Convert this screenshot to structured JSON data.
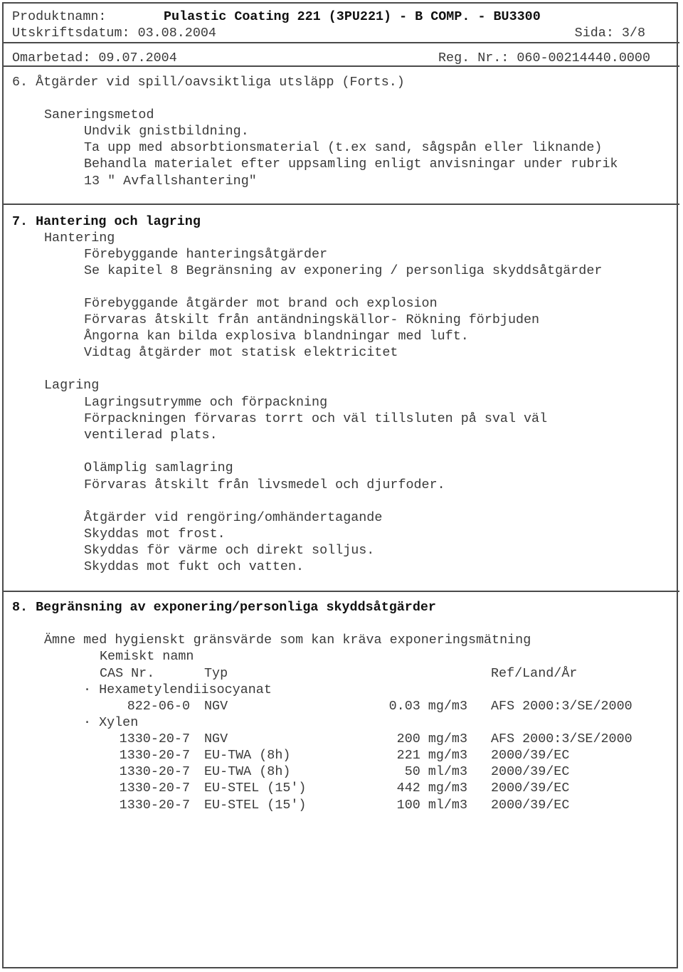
{
  "header": {
    "product_label": "Produktnamn:",
    "product_name": "Pulastic Coating 221 (3PU221) - B COMP. - BU3300",
    "print_date_label": "Utskriftsdatum: 03.08.2004",
    "page": "Sida: 3/8",
    "revised": "Omarbetad: 09.07.2004",
    "reg_nr": "Reg. Nr.: 060-00214440.0000"
  },
  "section6": {
    "title": "6. Åtgärder vid spill/oavsiktliga utsläpp (Forts.)",
    "subheading": "Saneringsmetod",
    "lines": [
      "Undvik gnistbildning.",
      "Ta upp med absorbtionsmaterial (t.ex sand, sågspån eller liknande)",
      "Behandla materialet efter uppsamling enligt anvisningar under rubrik",
      "13 \" Avfallshantering\""
    ]
  },
  "section7": {
    "title": "7. Hantering och lagring",
    "handling_heading": "Hantering",
    "handling_lines": [
      "Förebyggande hanteringsåtgärder",
      "Se kapitel 8 Begränsning av exponering / personliga skyddsåtgärder",
      "Förebyggande åtgärder mot brand och explosion",
      "Förvaras åtskilt från antändningskällor- Rökning förbjuden",
      "Ångorna kan bilda explosiva blandningar med luft.",
      "Vidtag åtgärder mot statisk elektricitet"
    ],
    "storage_heading": "Lagring",
    "storage_lines": [
      "Lagringsutrymme och förpackning",
      "Förpackningen förvaras torrt och väl tillsluten på sval väl",
      "ventilerad plats.",
      "Olämplig samlagring",
      "Förvaras åtskilt från livsmedel och djurfoder.",
      "Åtgärder vid rengöring/omhändertagande",
      "Skyddas mot frost.",
      "Skyddas för värme och direkt solljus.",
      "Skyddas mot fukt och vatten."
    ]
  },
  "section8": {
    "title": "8. Begränsning av exponering/personliga skyddsåtgärder",
    "intro": "Ämne med hygienskt gränsvärde som kan kräva exponeringsmätning",
    "col_chem": "Kemiskt namn",
    "col_cas": "CAS Nr.",
    "col_type": "Typ",
    "col_ref": "Ref/Land/År",
    "substances": [
      {
        "name": "· Hexametylendiisocyanat",
        "rows": [
          {
            "cas": "822-06-0",
            "type": "NGV",
            "value": "0.03 mg/m3",
            "ref": "AFS 2000:3/SE/2000"
          }
        ]
      },
      {
        "name": "· Xylen",
        "rows": [
          {
            "cas": "1330-20-7",
            "type": "NGV",
            "value": "200 mg/m3",
            "ref": "AFS 2000:3/SE/2000"
          },
          {
            "cas": "1330-20-7",
            "type": "EU-TWA (8h)",
            "value": "221 mg/m3",
            "ref": "2000/39/EC"
          },
          {
            "cas": "1330-20-7",
            "type": "EU-TWA (8h)",
            "value": "50 ml/m3",
            "ref": "2000/39/EC"
          },
          {
            "cas": "1330-20-7",
            "type": "EU-STEL (15')",
            "value": "442 mg/m3",
            "ref": "2000/39/EC"
          },
          {
            "cas": "1330-20-7",
            "type": "EU-STEL (15')",
            "value": "100 ml/m3",
            "ref": "2000/39/EC"
          }
        ]
      }
    ]
  }
}
